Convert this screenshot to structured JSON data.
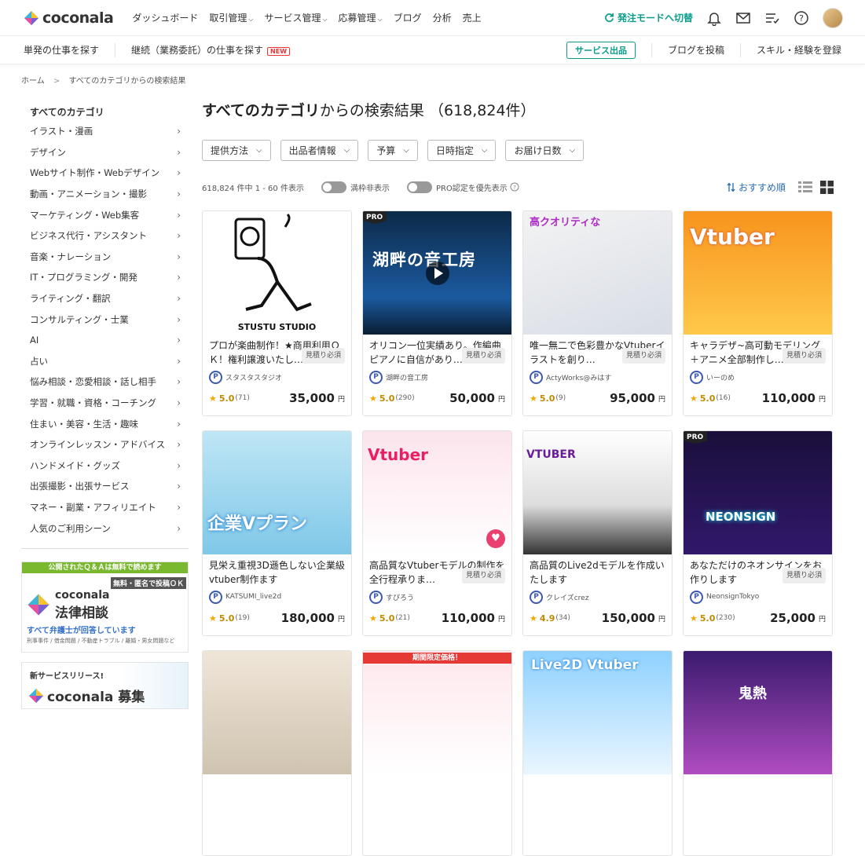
{
  "header": {
    "brand": "coconala",
    "nav": [
      "ダッシュボード",
      "取引管理",
      "サービス管理",
      "応募管理",
      "ブログ",
      "分析",
      "売上"
    ],
    "nav_has_dropdown": [
      false,
      true,
      true,
      true,
      false,
      false,
      false
    ],
    "mode_switch": "発注モードへ切替"
  },
  "subbar": {
    "find_single": "単発の仕事を探す",
    "find_contract": "継続（業務委託）の仕事を探す",
    "new_badge": "NEW",
    "post_service": "サービス出品",
    "post_blog": "ブログを投稿",
    "register_skill": "スキル・経験を登録"
  },
  "breadcrumb": {
    "home": "ホーム",
    "sep": ">",
    "current": "すべてのカテゴリからの検索結果"
  },
  "sidebar": {
    "title": "すべてのカテゴリ",
    "categories": [
      "イラスト・漫画",
      "デザイン",
      "Webサイト制作・Webデザイン",
      "動画・アニメーション・撮影",
      "マーケティング・Web集客",
      "ビジネス代行・アシスタント",
      "音楽・ナレーション",
      "IT・プログラミング・開発",
      "ライティング・翻訳",
      "コンサルティング・士業",
      "AI",
      "占い",
      "悩み相談・恋愛相談・話し相手",
      "学習・就職・資格・コーチング",
      "住まい・美容・生活・趣味",
      "オンラインレッスン・アドバイス",
      "ハンドメイド・グッズ",
      "出張撮影・出張サービス",
      "マネー・副業・アフィリエイト",
      "人気のご利用シーン"
    ],
    "banner1": {
      "top": "公開されたＱ＆Ａは無料で読めます",
      "tag": "無料・匿名で投稿ＯＫ",
      "brand": "coconala",
      "service": "法律相談",
      "blue": "すべて弁護士が回答しています",
      "small": "刑事事件 / 借金問題 / 不動産トラブル / 離婚・男女問題など"
    },
    "banner2": {
      "top": "新サービスリリース!",
      "brand": "coconala 募集"
    }
  },
  "main": {
    "title_bold": "すべてのカテゴリ",
    "title_rest": "からの検索結果",
    "count": "（618,824件）",
    "filters": [
      "提供方法",
      "出品者情報",
      "予算",
      "日時指定",
      "お届け日数"
    ],
    "summary": "618,824 件中 1 - 60 件表示",
    "toggle1": "満枠非表示",
    "toggle2": "PRO認定を優先表示",
    "sort": "おすすめ順"
  },
  "cards": [
    {
      "title": "プロが楽曲制作！★商用利用ＯＫ！権利譲渡いたし…",
      "quote": "見積り必須",
      "seller": "スタスタスタジオ",
      "rating": "5.0",
      "reviews": "(71)",
      "price": "35,000",
      "yen": "円",
      "pro": false,
      "thumb_text": "STUSTU STUDIO"
    },
    {
      "title": "オリコン一位実績あり。作編曲ピアノに自信があり…",
      "quote": "見積り必須",
      "seller": "湖畔の音工房",
      "rating": "5.0",
      "reviews": "(290)",
      "price": "50,000",
      "yen": "円",
      "pro": true,
      "thumb_text": "湖畔の音工房"
    },
    {
      "title": "唯一無二で色彩豊かなVtuberイラストを創り…",
      "quote": "見積り必須",
      "seller": "ActyWorks@みはす",
      "rating": "5.0",
      "reviews": "(9)",
      "price": "95,000",
      "yen": "円",
      "pro": false,
      "thumb_text": "高クオリティな"
    },
    {
      "title": "キャラデザ~高可動モデリング＋アニメ全部制作し…",
      "quote": "見積り必須",
      "seller": "いーのめ",
      "rating": "5.0",
      "reviews": "(16)",
      "price": "110,000",
      "yen": "円",
      "pro": false,
      "thumb_text": "Vtuber"
    },
    {
      "title": "見栄え重視3D遜色しない企業級vtuber制作ます",
      "quote": "",
      "seller": "KATSUMI_live2d",
      "rating": "5.0",
      "reviews": "(19)",
      "price": "180,000",
      "yen": "円",
      "pro": false,
      "thumb_text": "企業Vプラン"
    },
    {
      "title": "高品質なVtuberモデルの制作を全行程承りま…",
      "quote": "見積り必須",
      "seller": "すぴろう",
      "rating": "5.0",
      "reviews": "(21)",
      "price": "110,000",
      "yen": "円",
      "pro": false,
      "thumb_text": "Vtuber"
    },
    {
      "title": "高品質のLive2dモデルを作成いたします",
      "quote": "",
      "seller": "クレイズcrez",
      "rating": "4.9",
      "reviews": "(34)",
      "price": "150,000",
      "yen": "円",
      "pro": false,
      "thumb_text": "VTUBER"
    },
    {
      "title": "あなただけのネオンサインをお作りします",
      "quote": "見積り必須",
      "seller": "NeonsignTokyo",
      "rating": "5.0",
      "reviews": "(230)",
      "price": "25,000",
      "yen": "円",
      "pro": true,
      "thumb_text": "NEONSIGN"
    },
    {
      "title": "",
      "quote": "",
      "seller": "",
      "rating": "",
      "reviews": "",
      "price": "",
      "yen": "",
      "pro": false,
      "thumb_text": ""
    },
    {
      "title": "",
      "quote": "",
      "seller": "",
      "rating": "",
      "reviews": "",
      "price": "",
      "yen": "",
      "pro": false,
      "thumb_text": "期間限定価格！"
    },
    {
      "title": "",
      "quote": "",
      "seller": "",
      "rating": "",
      "reviews": "",
      "price": "",
      "yen": "",
      "pro": false,
      "thumb_text": "Live2D Vtuber"
    },
    {
      "title": "",
      "quote": "",
      "seller": "",
      "rating": "",
      "reviews": "",
      "price": "",
      "yen": "",
      "pro": false,
      "thumb_text": "鬼熱"
    }
  ]
}
